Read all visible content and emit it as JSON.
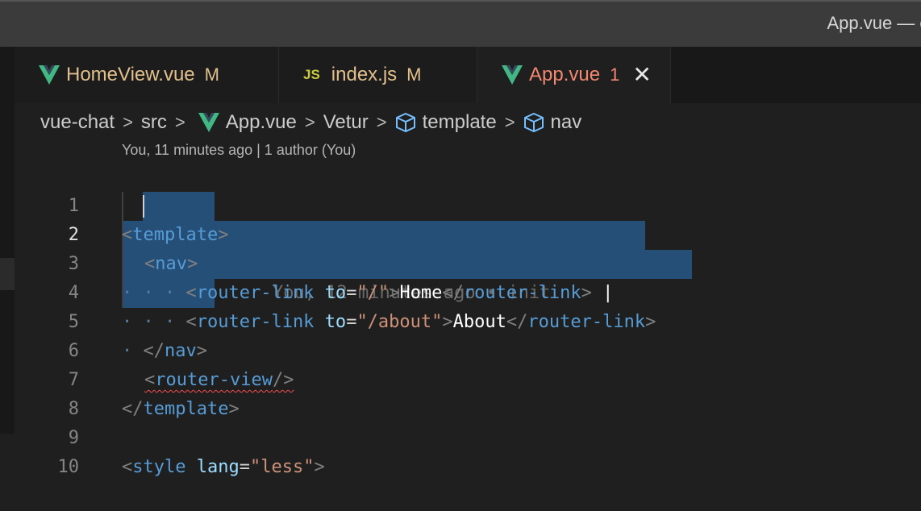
{
  "window": {
    "title": "App.vue — chat"
  },
  "tabs": [
    {
      "name": "HomeView.vue",
      "badge": "M",
      "kind": "vue"
    },
    {
      "name": "index.js",
      "badge": "M",
      "kind": "js",
      "icon_text": "JS"
    },
    {
      "name": "App.vue",
      "badge": "1",
      "kind": "vue",
      "active": true
    }
  ],
  "breadcrumb": {
    "items": [
      "vue-chat",
      "src",
      "App.vue",
      "Vetur",
      "template",
      "nav"
    ],
    "separator": ">"
  },
  "codelens": "You, 11 minutes ago | 1 author (You)",
  "inline_blame": "You, 12 minutes ago • init",
  "editor": {
    "line_numbers": [
      "1",
      "2",
      "3",
      "4",
      "5",
      "6",
      "7",
      "8",
      "9",
      "10"
    ],
    "tokens": {
      "lt": "<",
      "gt": ">",
      "close_lt": "</",
      "self_close": "/>",
      "template": "template",
      "nav": "nav",
      "router_link": "router-link",
      "router_view": "router-view",
      "style": "style",
      "to": "to",
      "lang": "lang",
      "eq": "=",
      "str_root": "\"/\"",
      "str_about": "\"/about\"",
      "str_less": "\"less\"",
      "text_home": "Home",
      "text_about": "About",
      "pipe": "|",
      "dots_2": "· ·",
      "dots_3": "· · ·",
      "dots_1": "·"
    }
  },
  "colors": {
    "selection": "#264f78",
    "tag": "#569cd6",
    "attribute": "#9cdcfe",
    "string": "#ce9178",
    "modified": "#e2c08d",
    "error": "#f48771",
    "vue_green": "#41b883"
  }
}
